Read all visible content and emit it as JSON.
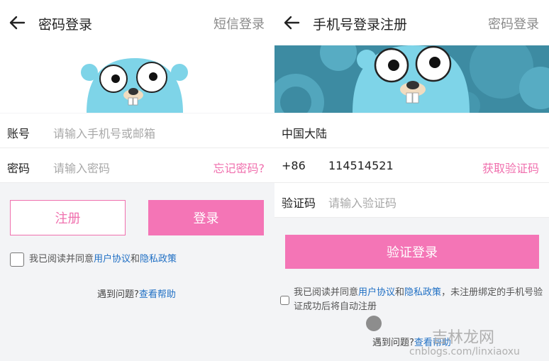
{
  "left": {
    "title": "密码登录",
    "switch_label": "短信登录",
    "account": {
      "label": "账号",
      "placeholder": "请输入手机号或邮箱"
    },
    "password": {
      "label": "密码",
      "placeholder": "请输入密码",
      "forgot": "忘记密码?"
    },
    "register_label": "注册",
    "login_label": "登录",
    "agree": {
      "prefix": "我已阅读并同意",
      "terms": "用户协议",
      "and": "和",
      "privacy": "隐私政策"
    },
    "help": {
      "prefix": "遇到问题?",
      "link": "查看帮助"
    }
  },
  "right": {
    "title": "手机号登录注册",
    "switch_label": "密码登录",
    "region": "中国大陆",
    "phone": {
      "code": "+86",
      "value": "114514521",
      "get_code": "获取验证码"
    },
    "verify": {
      "label": "验证码",
      "placeholder": "请输入验证码"
    },
    "verify_login_label": "验证登录",
    "agree": {
      "prefix": "我已阅读并同意",
      "terms": "用户协议",
      "and": "和",
      "privacy": "隐私政策",
      "suffix": "，未注册绑定的手机号验证成功后将自动注册"
    },
    "help": {
      "prefix": "遇到问题?",
      "link": "查看帮助"
    }
  },
  "watermark": {
    "site": "cnblogs.com/linxiaoxu",
    "brand": "吉林龙网"
  },
  "colors": {
    "accent": "#f475b6",
    "link": "#1f6fc4",
    "gopher": "#7ed4e8"
  },
  "icons": {
    "back": "back-arrow-icon",
    "mascot": "gopher-mascot"
  }
}
